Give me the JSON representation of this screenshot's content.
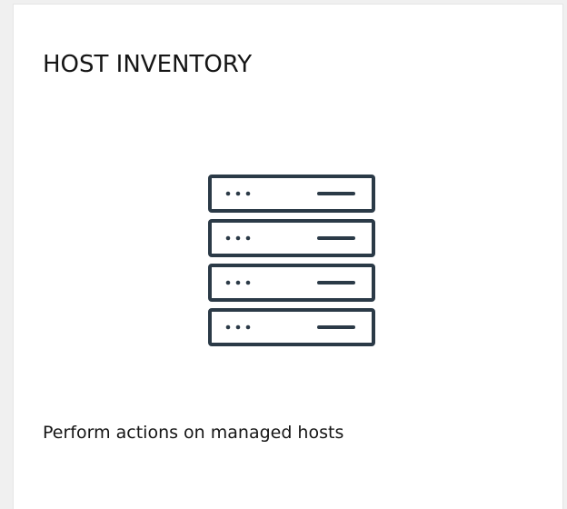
{
  "tile": {
    "title": "HOST INVENTORY",
    "description": "Perform actions on managed hosts",
    "icon": "server-rack-icon"
  },
  "colors": {
    "page_background": "#f0f0f0",
    "tile_background": "#ffffff",
    "icon_stroke": "#2b3a47",
    "text": "#151515"
  }
}
